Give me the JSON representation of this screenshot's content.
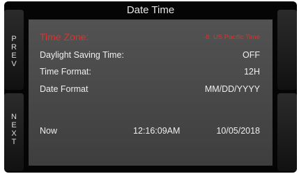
{
  "header": {
    "title": "Date Time"
  },
  "nav": {
    "prev": [
      "P",
      "R",
      "E",
      "V"
    ],
    "next": [
      "N",
      "E",
      "X",
      "T"
    ]
  },
  "settings": [
    {
      "label": "Time Zone:",
      "value": "-8: US Pacific Time"
    },
    {
      "label": "Daylight Saving Time:",
      "value": "OFF"
    },
    {
      "label": "Time Format:",
      "value": "12H"
    },
    {
      "label": "Date Format",
      "value": "MM/DD/YYYY"
    }
  ],
  "now": {
    "label": "Now",
    "time": "12:16:09AM",
    "date": "10/05/2018"
  },
  "colors": {
    "highlight": "#e0312b",
    "text": "#efefef"
  }
}
